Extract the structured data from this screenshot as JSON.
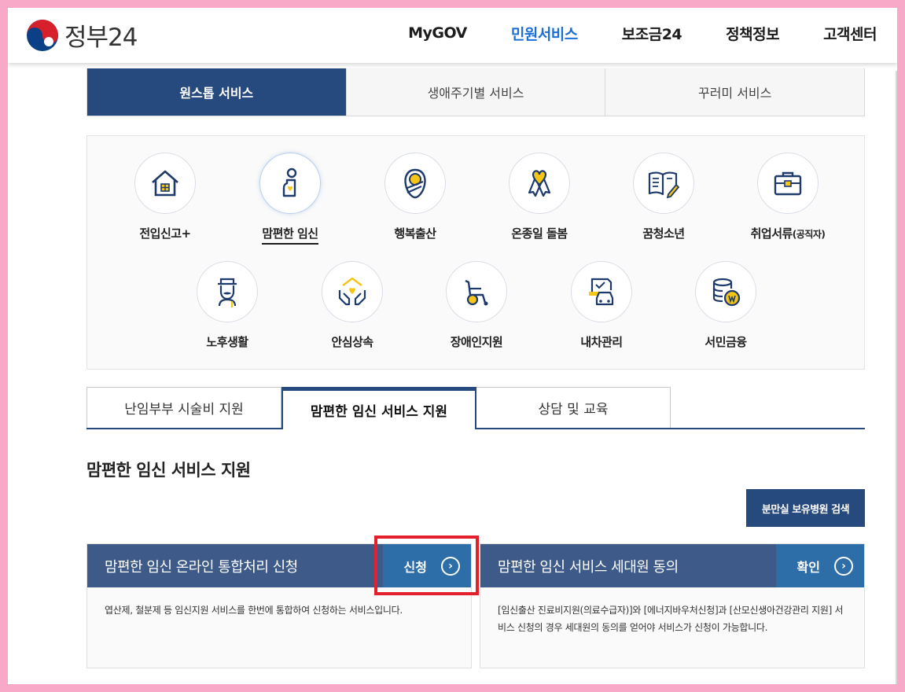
{
  "header": {
    "logo_text": "정부24",
    "nav": [
      {
        "label": "MyGOV"
      },
      {
        "label": "민원서비스",
        "active": true
      },
      {
        "label": "보조금24"
      },
      {
        "label": "정책정보"
      },
      {
        "label": "고객센터"
      }
    ]
  },
  "top_tabs": [
    {
      "label": "원스톱 서비스",
      "active": true
    },
    {
      "label": "생애주기별 서비스"
    },
    {
      "label": "꾸러미 서비스"
    }
  ],
  "services": [
    {
      "label": "전입신고+",
      "icon": "house-icon"
    },
    {
      "label": "맘편한 임신",
      "icon": "pregnant-woman-icon",
      "current": true
    },
    {
      "label": "행복출산",
      "icon": "baby-icon"
    },
    {
      "label": "온종일 돌봄",
      "icon": "ribbon-heart-icon"
    },
    {
      "label": "꿈청소년",
      "icon": "book-pencil-icon"
    },
    {
      "label": "취업서류",
      "label_small": "(공직자)",
      "icon": "briefcase-icon"
    },
    {
      "label": "노후생활",
      "icon": "elderly-man-icon"
    },
    {
      "label": "안심상속",
      "icon": "hands-heart-house-icon"
    },
    {
      "label": "장애인지원",
      "icon": "wheelchair-icon"
    },
    {
      "label": "내차관리",
      "icon": "car-document-icon"
    },
    {
      "label": "서민금융",
      "icon": "coins-won-icon"
    }
  ],
  "sub_tabs": [
    {
      "label": "난임부부 시술비 지원"
    },
    {
      "label": "맘편한 임신 서비스 지원",
      "active": true
    },
    {
      "label": "상담 및 교육"
    }
  ],
  "section_title": "맘편한 임신 서비스 지원",
  "search_button": "분만실 보유병원 검색",
  "cards": [
    {
      "title": "맘편한 임신 온라인 통합처리 신청",
      "action": "신청",
      "desc": "엽산제, 철분제 등 임신지원 서비스를 한번에 통합하여 신청하는 서비스입니다."
    },
    {
      "title": "맘편한 임신 서비스 세대원 동의",
      "action": "확인",
      "desc": "[임신출산 진료비지원(의료수급자)]와 [에너지바우처신청]과 [산모신생아건강관리 지원] 서비스 신청의 경우 세대원의 동의를 얻어야 서비스가 신청이 가능합니다."
    }
  ],
  "colors": {
    "primary": "#274a7e",
    "card_head": "#3d5a88",
    "action": "#2d6ea8",
    "nav_active": "#1a6fd6",
    "highlight": "#e3202b",
    "icon_yellow": "#f5c518"
  }
}
